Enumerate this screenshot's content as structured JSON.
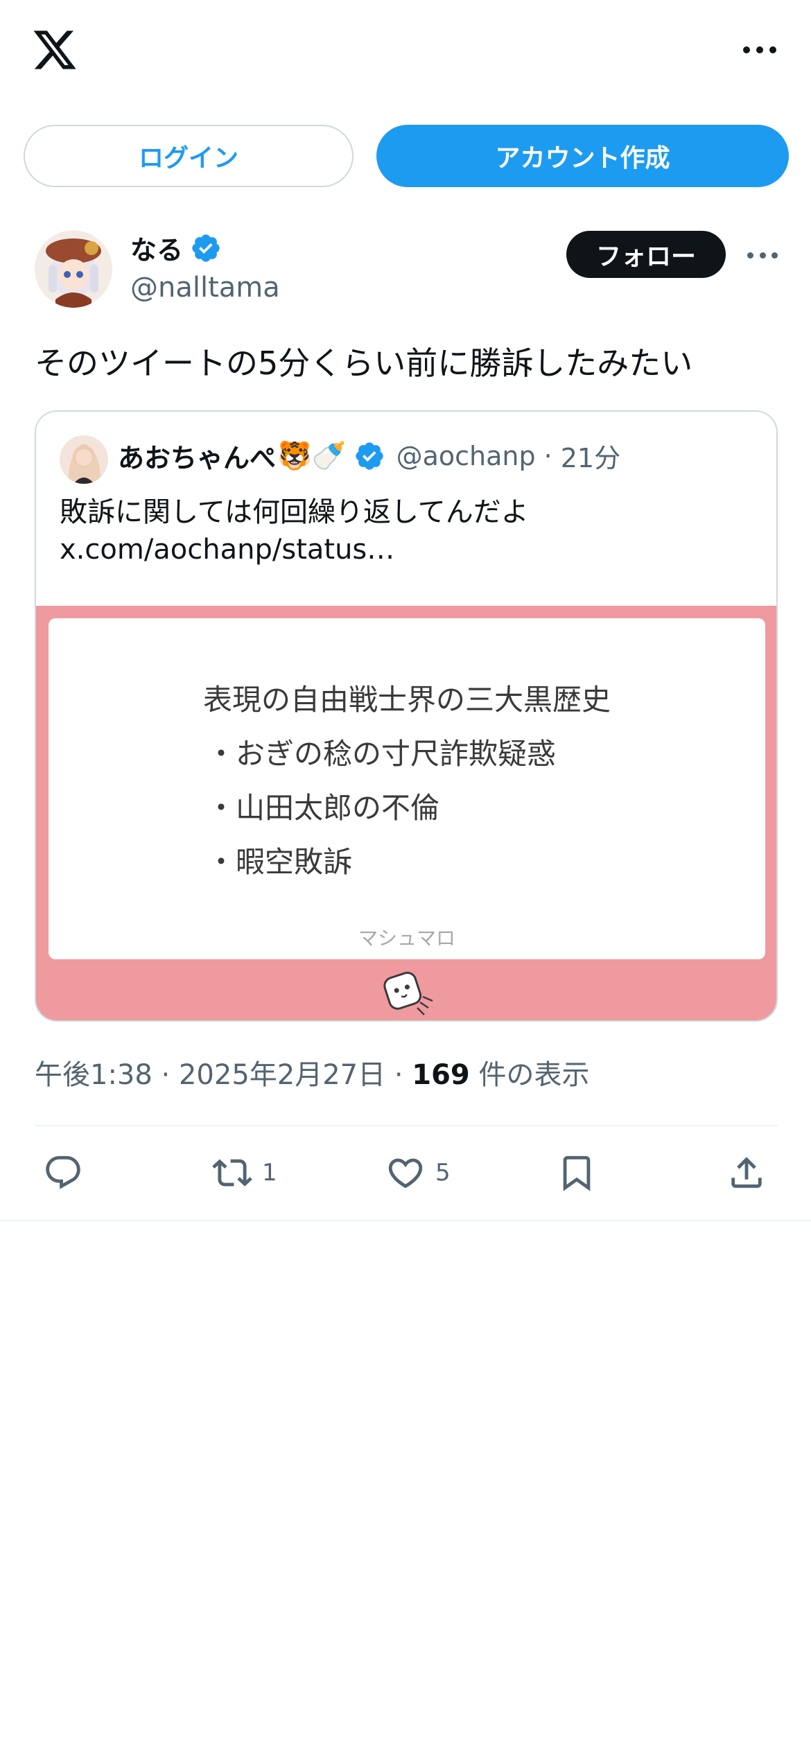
{
  "header": {
    "logo_icon": "x-logo-icon",
    "more_icon": "more-dots-icon"
  },
  "auth": {
    "login_label": "ログイン",
    "signup_label": "アカウント作成"
  },
  "tweet": {
    "author_name": "なる",
    "author_handle": "@nalltama",
    "follow_label": "フォロー",
    "text": "そのツイートの5分くらい前に勝訴したみたい",
    "timestamp": "午後1:38 · 2025年2月27日 · ",
    "views_count": "169",
    "views_label": " 件の表示"
  },
  "quote": {
    "author_name": "あおちゃんぺ",
    "author_emoji": "🐯🍼",
    "author_handle": "@aochanp",
    "separator": "·",
    "time": "21分",
    "text_line1": "敗訴に関しては何回繰り返してんだよ",
    "text_line2": "x.com/aochanp/status…",
    "card": {
      "title": "表現の自由戦士界の三大黒歴史",
      "items": [
        "・おぎの稔の寸尺詐欺疑惑",
        "・山田太郎の不倫",
        "・暇空敗訴"
      ],
      "footer": "マシュマロ"
    }
  },
  "actions": {
    "reply_icon": "reply-icon",
    "repost_icon": "repost-icon",
    "repost_count": "1",
    "like_icon": "heart-icon",
    "like_count": "5",
    "bookmark_icon": "bookmark-icon",
    "share_icon": "share-icon"
  },
  "colors": {
    "accent": "#1d9bf0",
    "text": "#0f1419",
    "muted": "#536471",
    "card_bg": "#ef9a9e"
  }
}
